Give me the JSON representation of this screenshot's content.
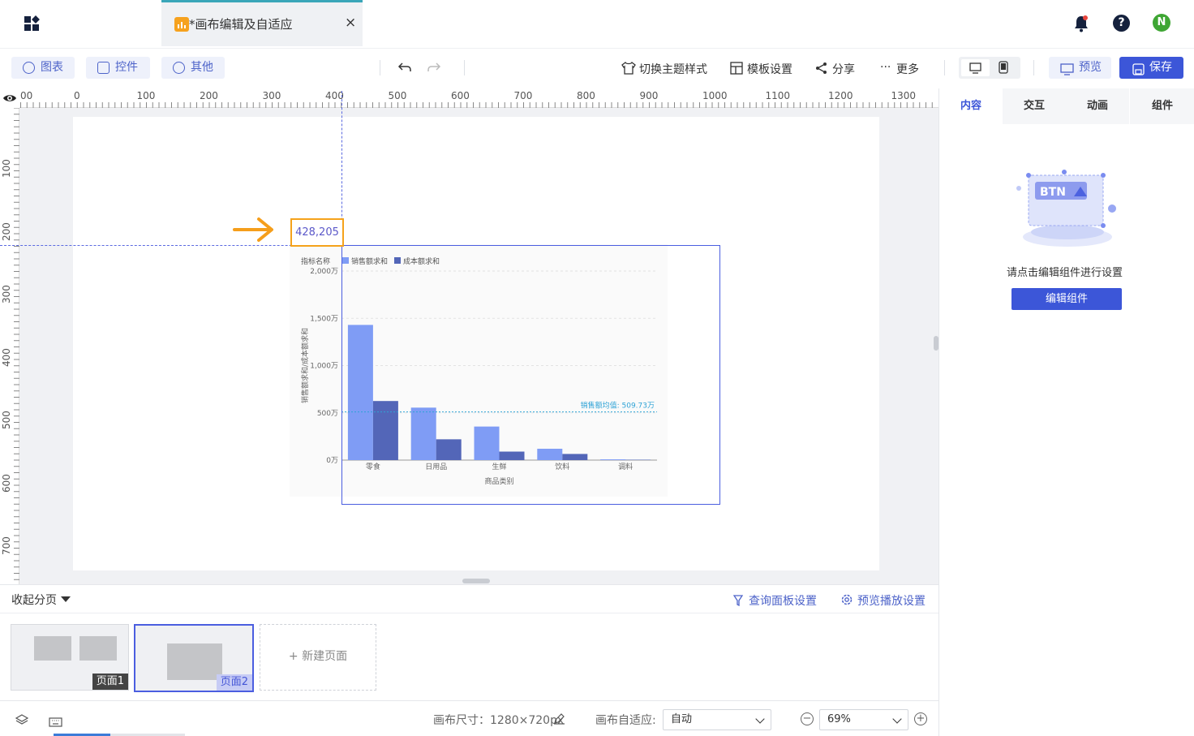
{
  "header": {
    "tab_title": "*画布编辑及自适应",
    "tab_close": "×",
    "help": "?",
    "avatar_initial": "N"
  },
  "toolbar": {
    "chart_label": "图表",
    "control_label": "控件",
    "other_label": "其他",
    "theme_label": "切换主题样式",
    "template_label": "模板设置",
    "share_label": "分享",
    "more_label": "更多",
    "preview_label": "预览",
    "save_label": "保存"
  },
  "ruler": {
    "top_labels": [
      "00",
      "0",
      "100",
      "200",
      "300",
      "400",
      "500",
      "600",
      "700",
      "800",
      "900",
      "1000",
      "1100",
      "1200",
      "1300"
    ],
    "left_labels": [
      "100",
      "200",
      "300",
      "400",
      "500",
      "600",
      "700"
    ]
  },
  "canvas": {
    "coordinate_readout": "428,205"
  },
  "chart_data": {
    "type": "bar",
    "title": "",
    "legend_title": "指标名称",
    "series": [
      {
        "name": "销售额求和",
        "color": "#7f9cf5",
        "values": [
          1430,
          555,
          355,
          120,
          8
        ]
      },
      {
        "name": "成本额求和",
        "color": "#5366b8",
        "values": [
          625,
          220,
          90,
          65,
          4
        ]
      }
    ],
    "categories": [
      "零食",
      "日用品",
      "生鲜",
      "饮料",
      "调料"
    ],
    "xlabel": "商品类别",
    "ylabel": "销售额求和/成本额求和",
    "ylim": [
      0,
      2000
    ],
    "yticks": [
      "0万",
      "500万",
      "1,000万",
      "1,500万",
      "2,000万"
    ],
    "ytick_values": [
      0,
      500,
      1000,
      1500,
      2000
    ],
    "reference_line": {
      "label": "销售额均值: 509.73万",
      "value": 509.73,
      "color": "#2fa3d6"
    },
    "legend_position": "top-left",
    "grid": true
  },
  "right_panel": {
    "tabs": [
      "内容",
      "交互",
      "动画",
      "组件"
    ],
    "illustration_text": "BTN",
    "empty_text": "请点击编辑组件进行设置",
    "edit_button": "编辑组件"
  },
  "pages": {
    "collapse_label": "收起分页",
    "query_settings": "查询面板设置",
    "play_settings": "预览播放设置",
    "items": [
      {
        "label": "页面1"
      },
      {
        "label": "页面2"
      }
    ],
    "new_page": "+ 新建页面"
  },
  "statusbar": {
    "canvas_size": "画布尺寸：1280×720px",
    "adapt_label": "画布自适应:",
    "adapt_value": "自动",
    "zoom_value": "69%",
    "zoom_out": "−",
    "zoom_in": "+"
  },
  "colors": {
    "accent": "#3c56d8",
    "guide": "#5b6ae0",
    "coordinate_border": "#f5a21b",
    "arrow": "#f59e1b"
  }
}
